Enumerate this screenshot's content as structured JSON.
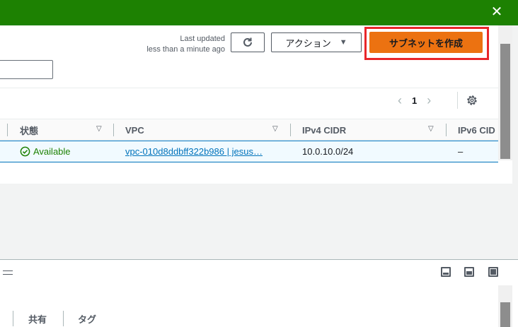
{
  "flash": {
    "close_icon": "close-icon"
  },
  "toolbar": {
    "last_updated_line1": "Last updated",
    "last_updated_line2": "less than a minute ago",
    "refresh_icon": "refresh-icon",
    "actions_label": "アクション",
    "create_subnet_label": "サブネットを作成"
  },
  "pagination": {
    "current_page": "1"
  },
  "table": {
    "columns": [
      "状態",
      "VPC",
      "IPv4 CIDR",
      "IPv6 CID"
    ],
    "rows": [
      {
        "status": "Available",
        "vpc": "vpc-010d8ddbff322b986 | jesus…",
        "ipv4": "10.0.10.0/24",
        "ipv6": "–"
      }
    ]
  },
  "detail_tabs": [
    "共有",
    "タグ"
  ],
  "colors": {
    "accent": "#ec7211",
    "success": "#1d8102",
    "link": "#0073bb",
    "highlight": "#e8262a"
  }
}
